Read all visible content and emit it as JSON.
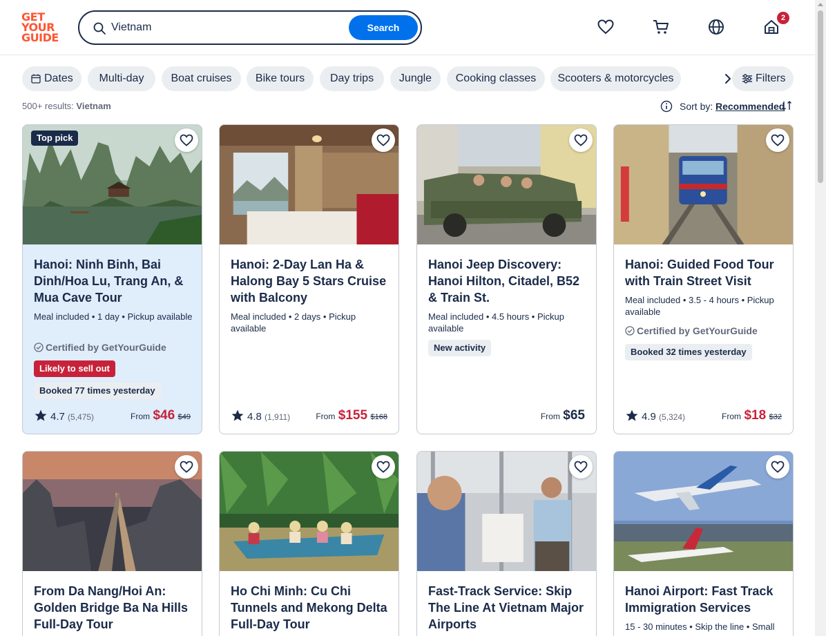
{
  "header": {
    "logo_lines": [
      "GET",
      "YOUR",
      "GUIDE"
    ],
    "search_value": "Vietnam",
    "search_button": "Search",
    "cart_count": "2"
  },
  "chips": [
    "Dates",
    "Multi-day",
    "Boat cruises",
    "Bike tours",
    "Day trips",
    "Jungle",
    "Cooking classes",
    "Scooters & motorcycles"
  ],
  "filters_label": "Filters",
  "results": {
    "count": "500+ results:",
    "query": "Vietnam"
  },
  "sort": {
    "label": "Sort by:",
    "value": "Recommended"
  },
  "cards": [
    {
      "badge": "Top pick",
      "title": "Hanoi: Ninh Binh, Bai Dinh/Hoa Lu, Trang An, & Mua Cave Tour",
      "meta": "Meal included • 1 day • Pickup available",
      "certified": "Certified by GetYourGuide",
      "urgency": "Likely to sell out",
      "booked": "Booked 77 times yesterday",
      "rating": "4.7",
      "reviews": "(5,475)",
      "from": "From",
      "price": "$46",
      "old_price": "$49"
    },
    {
      "title": "Hanoi: 2-Day Lan Ha & Halong Bay 5 Stars Cruise with Balcony",
      "meta": "Meal included • 2 days • Pickup available",
      "rating": "4.8",
      "reviews": "(1,911)",
      "from": "From",
      "price": "$155",
      "old_price": "$168"
    },
    {
      "title": "Hanoi Jeep Discovery: Hanoi Hilton, Citadel, B52 & Train St.",
      "meta": "Meal included • 4.5 hours • Pickup available",
      "new_tag": "New activity",
      "from": "From",
      "price": "$65"
    },
    {
      "title": "Hanoi: Guided Food Tour with Train Street Visit",
      "meta": "Meal included • 3.5 - 4 hours • Pickup available",
      "certified": "Certified by GetYourGuide",
      "booked": "Booked 32 times yesterday",
      "rating": "4.9",
      "reviews": "(5,324)",
      "from": "From",
      "price": "$18",
      "old_price": "$32"
    },
    {
      "title": "From Da Nang/Hoi An: Golden Bridge Ba Na Hills Full-Day Tour"
    },
    {
      "title": "Ho Chi Minh: Cu Chi Tunnels and Mekong Delta Full-Day Tour"
    },
    {
      "title": "Fast-Track Service: Skip The Line At Vietnam Major Airports"
    },
    {
      "title": "Hanoi Airport: Fast Track Immigration Services",
      "meta": "15 - 30 minutes • Skip the line • Small"
    }
  ]
}
